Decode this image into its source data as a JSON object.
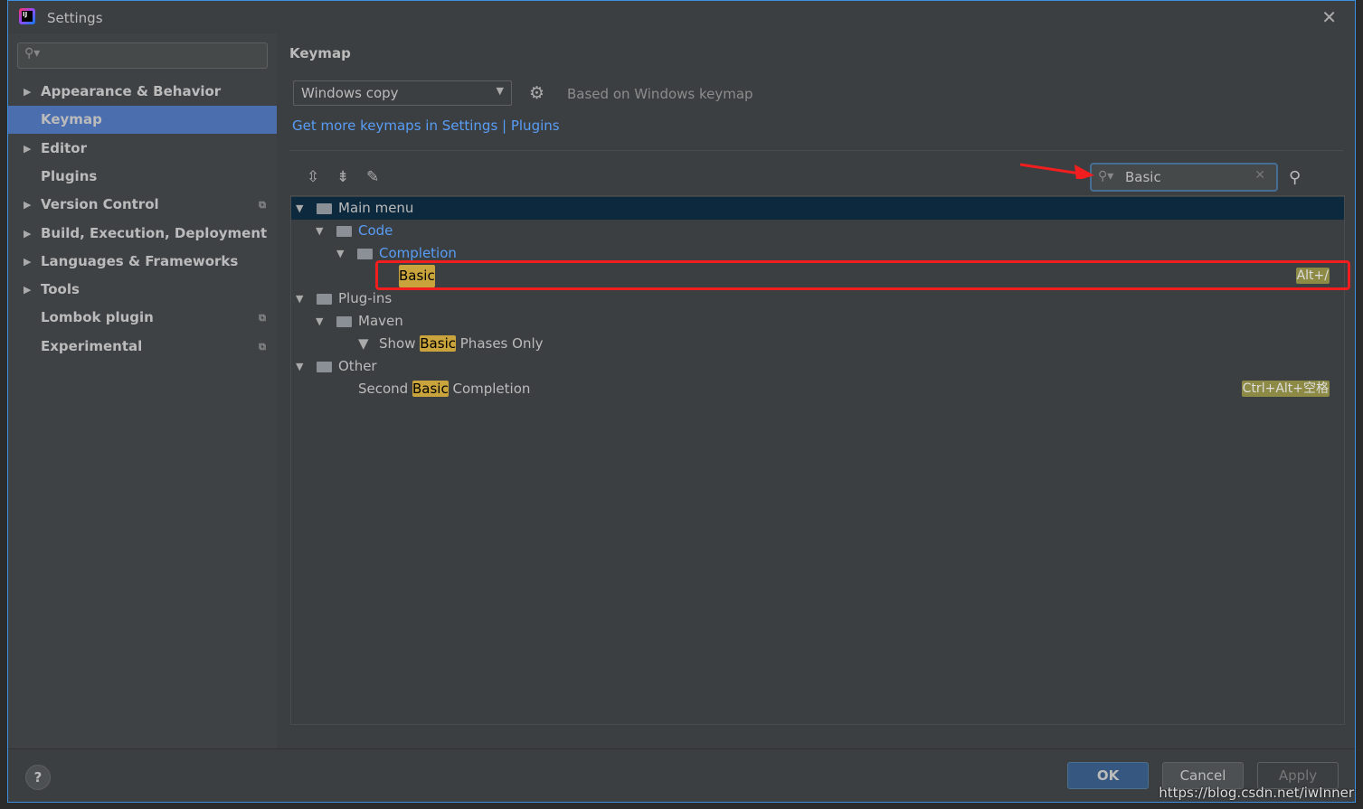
{
  "window": {
    "title": "Settings",
    "close": "✕"
  },
  "sidebar": {
    "search_icon": "⚲▾",
    "items": [
      {
        "label": "Appearance & Behavior",
        "arrow": "▶",
        "copy": ""
      },
      {
        "label": "Keymap",
        "arrow": "",
        "copy": ""
      },
      {
        "label": "Editor",
        "arrow": "▶",
        "copy": ""
      },
      {
        "label": "Plugins",
        "arrow": "",
        "copy": ""
      },
      {
        "label": "Version Control",
        "arrow": "▶",
        "copy": "⧉"
      },
      {
        "label": "Build, Execution, Deployment",
        "arrow": "▶",
        "copy": ""
      },
      {
        "label": "Languages & Frameworks",
        "arrow": "▶",
        "copy": ""
      },
      {
        "label": "Tools",
        "arrow": "▶",
        "copy": ""
      },
      {
        "label": "Lombok plugin",
        "arrow": "",
        "copy": "⧉"
      },
      {
        "label": "Experimental",
        "arrow": "",
        "copy": "⧉"
      }
    ]
  },
  "keymap": {
    "heading": "Keymap",
    "selected": "Windows copy",
    "based_on": "Based on Windows keymap",
    "link": "Get more keymaps in Settings | Plugins",
    "search_value": "Basic",
    "tree": {
      "main_menu": "Main menu",
      "code": "Code",
      "completion": "Completion",
      "basic": "Basic",
      "basic_shortcut": "Alt+/",
      "plugins": "Plug-ins",
      "maven": "Maven",
      "show": "Show",
      "hl": "Basic",
      "phases": "Phases Only",
      "other": "Other",
      "second": "Second",
      "completion2": "Completion",
      "second_shortcut": "Ctrl+Alt+空格"
    }
  },
  "footer": {
    "help": "?",
    "ok": "OK",
    "cancel": "Cancel",
    "apply": "Apply"
  },
  "watermark": "https://blog.csdn.net/iwInner",
  "colors": {
    "selection": "#4b6eaf",
    "highlight": "#c9a43c",
    "annotation": "#f01e1e"
  }
}
